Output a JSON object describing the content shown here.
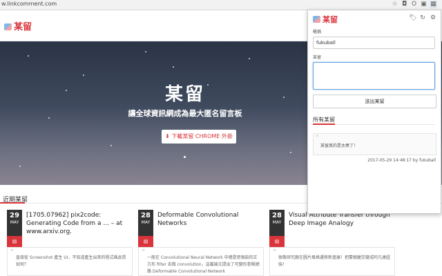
{
  "browser": {
    "url": "w.linkcomment.com"
  },
  "site": {
    "logo": "某留"
  },
  "hero": {
    "title": "某留",
    "subtitle": "讓全球資訊網成為最大匿名留言板",
    "download_button": "下載某留 CHROME 外掛"
  },
  "recent": {
    "heading": "近期某留",
    "cards": [
      {
        "day": "29",
        "month": "MAY",
        "title": "[1705.07962] pix2code: Generating Code from a ... – at www.arxiv.org.",
        "comment": "直接從 Screenshot 產生 UI，不知道產生出來的程式碼品質如何？"
      },
      {
        "day": "28",
        "month": "MAY",
        "title": "Deformable Convolutional Networks",
        "comment": "一般在 Convolutional Neural Network 中總是用預設的正方形 filter 去做 convolution，這篇論文提出了可變形卷積網路 Deformable Convolutional Network"
      },
      {
        "day": "28",
        "month": "MAY",
        "title": "Visual Attribute Transfer through Deep Image Analogy",
        "comment": "很敬研究跟在圖片風格遷移新進展！把蒙娜麗莎變成阿凡達超強！"
      }
    ]
  },
  "popup": {
    "logo": "某留",
    "nickname_label": "暱稱",
    "nickname_value": "fukuball",
    "comment_label": "某留",
    "comment_value": "",
    "submit_label": "送出某留",
    "all_heading": "所有某留",
    "comments": [
      {
        "text": "某留真的是太棒了！",
        "meta": "2017-05-29 14:48:17 by fukuball"
      }
    ]
  },
  "icons": {
    "download": "download-icon",
    "pdf": "pdf-icon",
    "tag": "tag-icon",
    "refresh": "refresh-icon",
    "settings": "gear-icon"
  },
  "colors": {
    "accent": "#d9343a",
    "date_bg": "#333333"
  }
}
